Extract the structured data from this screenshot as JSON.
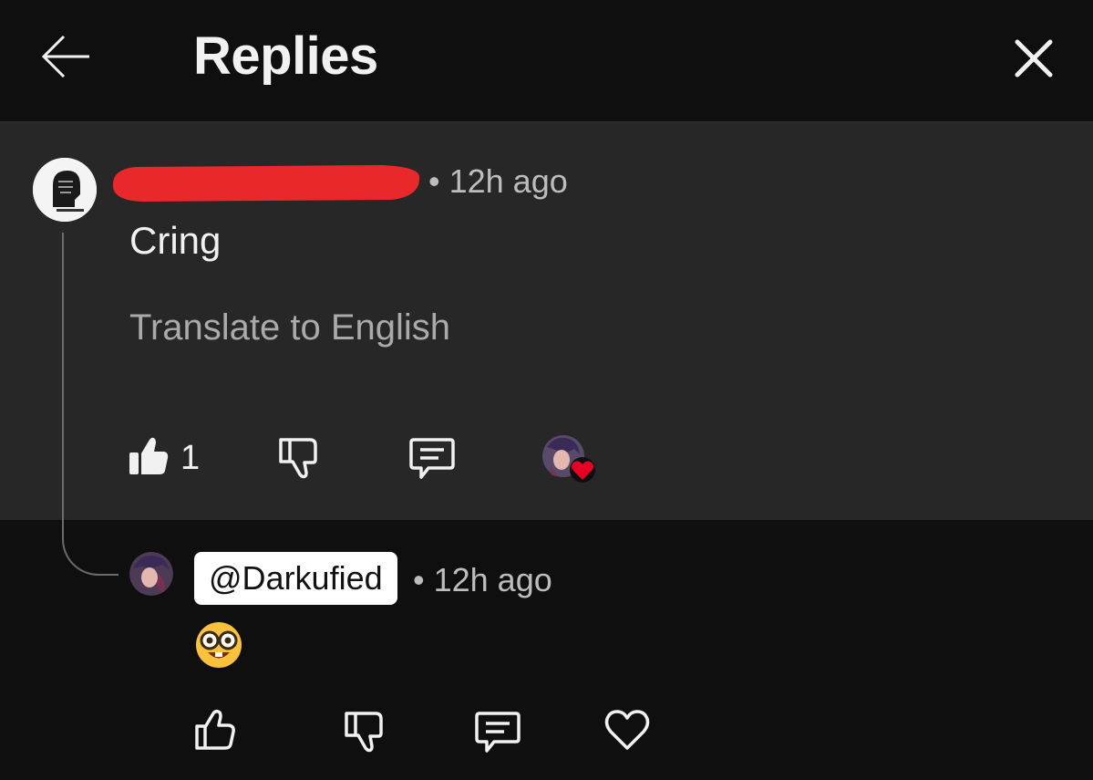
{
  "header": {
    "title": "Replies"
  },
  "parent_comment": {
    "timestamp": "• 12h ago",
    "text": "Cring",
    "translate_label": "Translate to English",
    "like_count": "1"
  },
  "reply": {
    "mention": "@Darkufied",
    "timestamp": "• 12h ago",
    "emoji": "🤓"
  },
  "colors": {
    "background": "#0f0f0f",
    "panel": "#272727",
    "redaction": "#e8282b",
    "heart": "#e60023"
  },
  "icons": {
    "back": "arrow-left-icon",
    "close": "close-icon",
    "like": "thumbs-up-icon",
    "dislike": "thumbs-down-icon",
    "reply": "comment-icon",
    "heart": "heart-icon"
  }
}
